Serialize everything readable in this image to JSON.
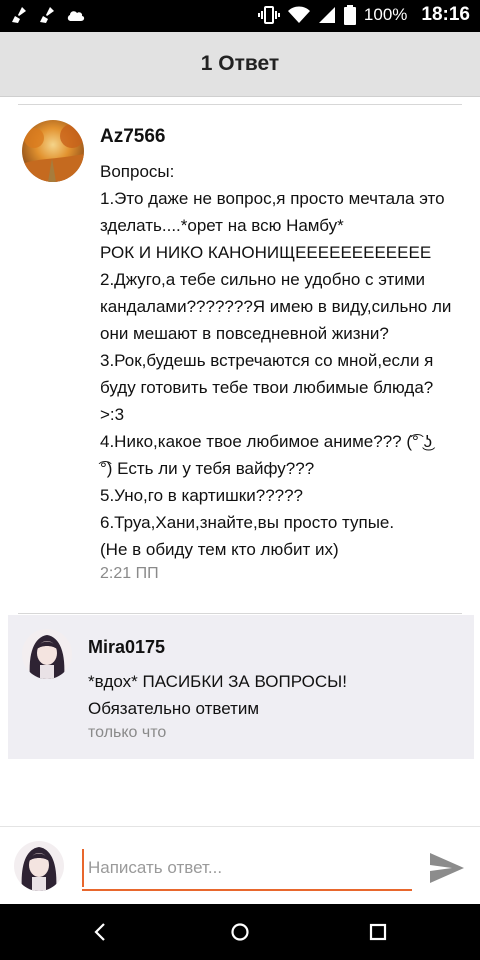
{
  "status_bar": {
    "battery": "100%",
    "time": "18:16",
    "left_icons": [
      "broom-icon",
      "broom-icon",
      "cloud-icon"
    ],
    "right_icons": [
      "vibrate-icon",
      "wifi-icon",
      "signal-icon",
      "battery-icon"
    ]
  },
  "header": {
    "title": "1 Ответ"
  },
  "comment": {
    "author": "Az7566",
    "lines": [
      "Вопросы:",
      "1.Это даже не вопрос,я просто мечтала это",
      "зделать....*орет на всю Намбу*",
      "РОК И НИКО КАНОНИЩЕЕЕЕЕЕЕЕЕЕЕЕ",
      "2.Джуго,а тебе сильно не удобно с этими",
      "кандалами???????Я имею в виду,сильно ли",
      "они мешают в повседневной жизни?",
      "3.Рок,будешь встречаются со мной,если я",
      "буду готовить тебе твои любимые блюда?",
      ">:3",
      "4.Нико,какое твое любимое аниме??? (͡° ͜ʖ",
      "͡°) Есть ли у тебя вайфу???",
      "5.Уно,го в картишки?????",
      "6.Труа,Хани,знайте,вы просто тупые.",
      "(Не в обиду тем кто любит их)"
    ],
    "time": "2:21 ПП"
  },
  "reply": {
    "author": "Mira0175",
    "lines": [
      "*вдох* ПАСИБКИ ЗА ВОПРОСЫ!",
      "Обязательно ответим"
    ],
    "time": "только что"
  },
  "composer": {
    "placeholder": "Написать ответ...",
    "accent_color": "#e8672d"
  },
  "nav": {
    "icons": [
      "back-icon",
      "home-icon",
      "recents-icon"
    ]
  }
}
